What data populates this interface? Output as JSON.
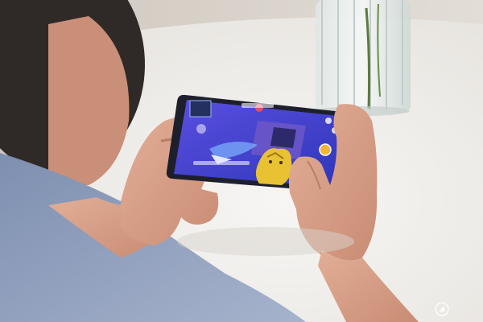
{
  "photo": {
    "palette": {
      "wall": "#d9d4cd",
      "table": "#f2f1ef",
      "shirt": "#8fa0be",
      "skin": "#d99e86",
      "phone_frame": "#1d1f2b",
      "game_sky": "#3a3fc7",
      "game_gold": "#e8c233"
    },
    "watermark_icon": "compass-icon"
  }
}
